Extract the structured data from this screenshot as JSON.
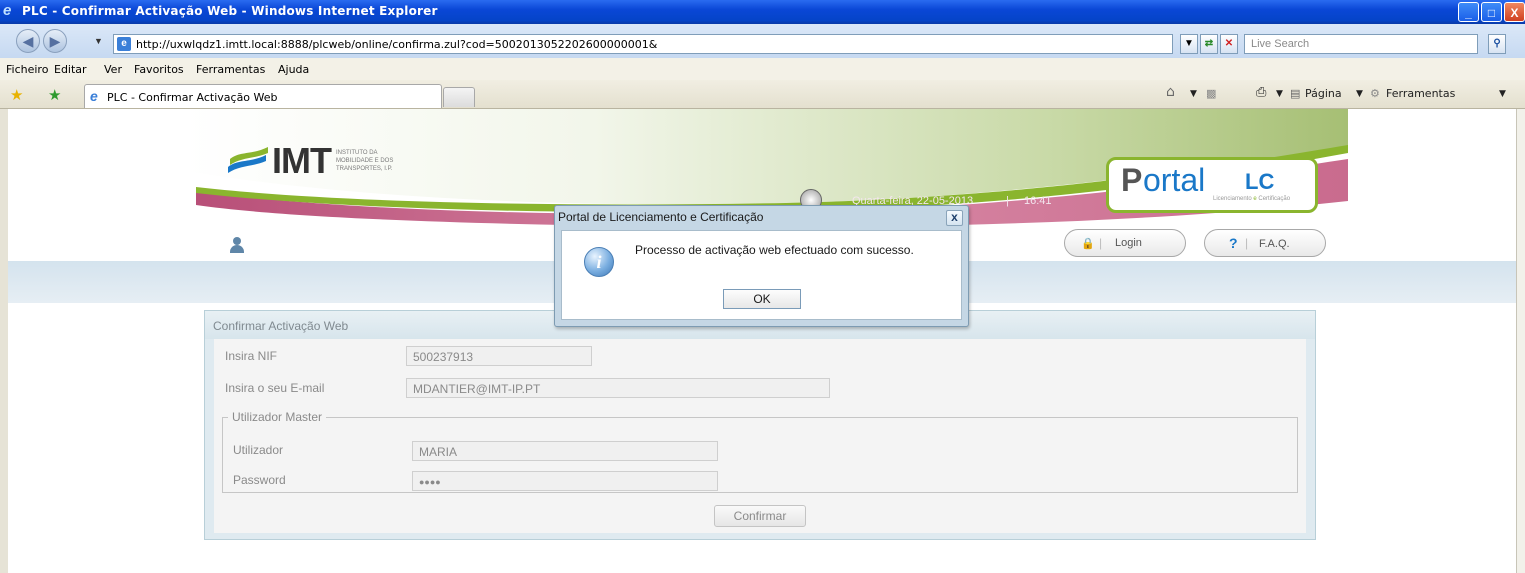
{
  "window": {
    "title": "PLC - Confirmar Activação Web - Windows Internet Explorer",
    "buttons": [
      "_",
      "□",
      "X"
    ]
  },
  "address_bar": {
    "url": "http://uxwlqdz1.imtt.local:8888/plcweb/online/confirma.zul?cod=5002013052202600000001&",
    "search_placeholder": "Live Search"
  },
  "menu": [
    "Ficheiro",
    "Editar",
    "Ver",
    "Favoritos",
    "Ferramentas",
    "Ajuda"
  ],
  "tabs": {
    "active": "PLC - Confirmar Activação Web"
  },
  "toolbar": {
    "page": "Página",
    "tools": "Ferramentas"
  },
  "header": {
    "logo_text": "IMT",
    "institute_line1": "INSTITUTO DA",
    "institute_line2": "MOBILIDADE E DOS",
    "institute_line3": "TRANSPORTES, I.P.",
    "date": "Quarta-feira, 22-05-2013",
    "separator": "|",
    "time": "16:41",
    "portal_p": "P",
    "portal_rest": "ortal",
    "portal_lc": "LC",
    "portal_sub_a": "Licenciamento",
    "portal_sub_e": "e",
    "portal_sub_b": "Certificação",
    "login_label": "Login",
    "faq_q": "?",
    "faq_label": "F.A.Q."
  },
  "form": {
    "title": "Confirmar Activação Web",
    "nif_label": "Insira NIF",
    "nif_value": "500237913",
    "email_label": "Insira o seu E-mail",
    "email_value": "MDANTIER@IMT-IP.PT",
    "group_label": "Utilizador Master",
    "user_label": "Utilizador",
    "user_value": "MARIA",
    "password_label": "Password",
    "password_value": "●●●●",
    "confirm_label": "Confirmar"
  },
  "dialog": {
    "title": "Portal de Licenciamento e Certificação",
    "message": "Processo de activação web efectuado com sucesso.",
    "ok_label": "OK",
    "close_label": "x",
    "icon_glyph": "i"
  },
  "colors": {
    "pink": "#c86a8e",
    "green": "#8ab52e",
    "blue": "#1a78c8"
  }
}
